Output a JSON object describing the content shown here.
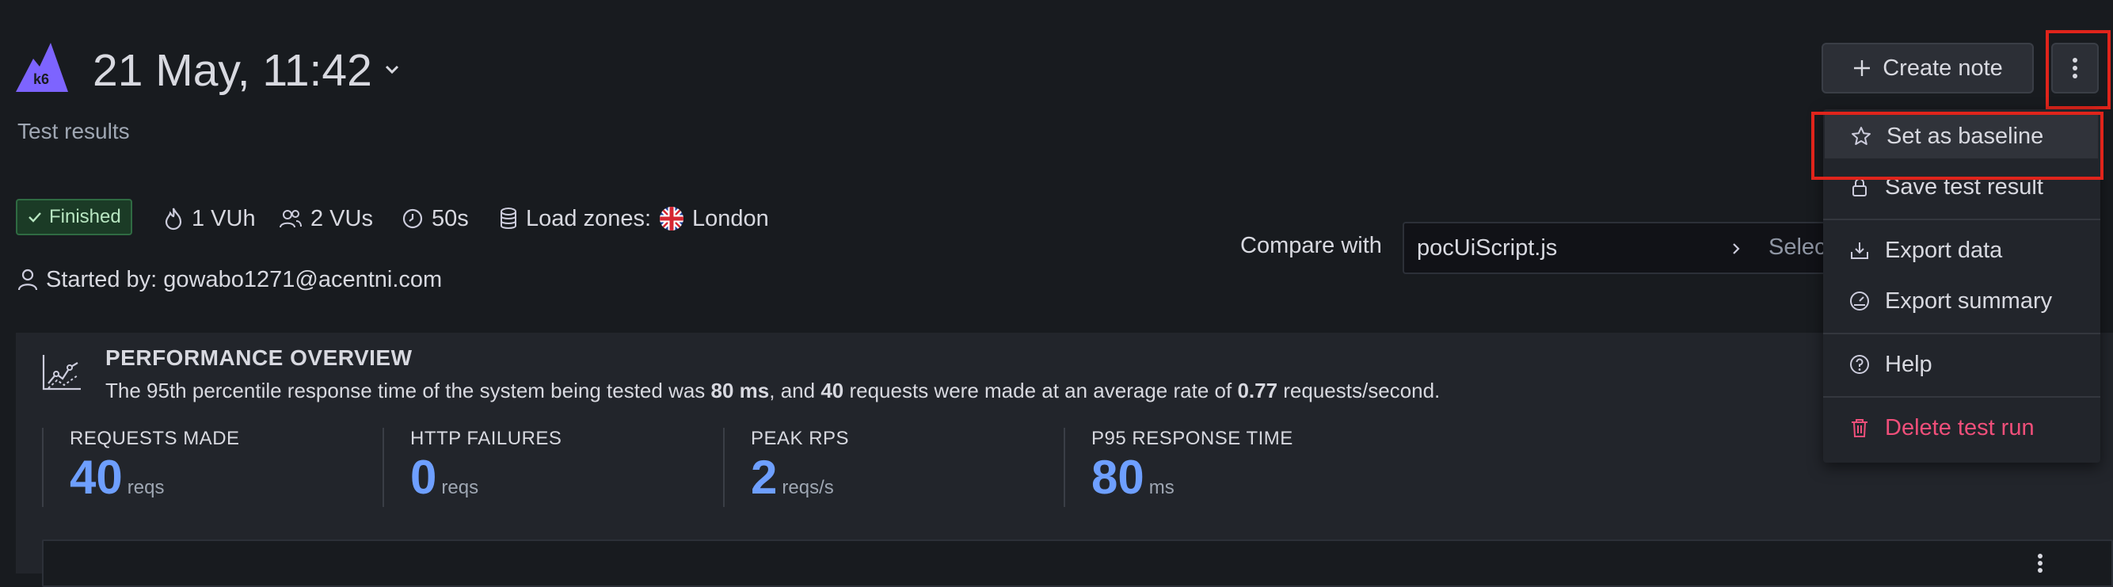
{
  "header": {
    "title": "21 May, 11:42",
    "subtitle": "Test results",
    "create_note_label": "Create note"
  },
  "meta": {
    "status": "Finished",
    "vuh": "1 VUh",
    "vus": "2 VUs",
    "duration": "50s",
    "load_zones_label": "Load zones:",
    "load_zone": "London",
    "started_by": "Started by: gowabo1271@acentni.com"
  },
  "compare": {
    "label": "Compare with",
    "script": "pocUiScript.js",
    "select_placeholder": "Select"
  },
  "performance": {
    "title": "PERFORMANCE OVERVIEW",
    "desc_1": "The 95th percentile response time of the system being tested was ",
    "desc_p95": "80 ms",
    "desc_2": ", and ",
    "desc_reqs": "40",
    "desc_3": " requests were made at an average rate of ",
    "desc_rate": "0.77",
    "desc_4": " requests/second.",
    "metrics": [
      {
        "label": "REQUESTS MADE",
        "value": "40",
        "unit": "reqs"
      },
      {
        "label": "HTTP FAILURES",
        "value": "0",
        "unit": "reqs"
      },
      {
        "label": "PEAK RPS",
        "value": "2",
        "unit": "reqs/s"
      },
      {
        "label": "P95 RESPONSE TIME",
        "value": "80",
        "unit": "ms"
      }
    ]
  },
  "menu": {
    "set_baseline": "Set as baseline",
    "save_result": "Save test result",
    "export_data": "Export data",
    "export_summary": "Export summary",
    "help": "Help",
    "delete_run": "Delete test run"
  },
  "colors": {
    "accent": "#6e9fff",
    "danger": "#f04f7a",
    "success_bg": "#1b3b26",
    "highlight": "#e0241b"
  }
}
